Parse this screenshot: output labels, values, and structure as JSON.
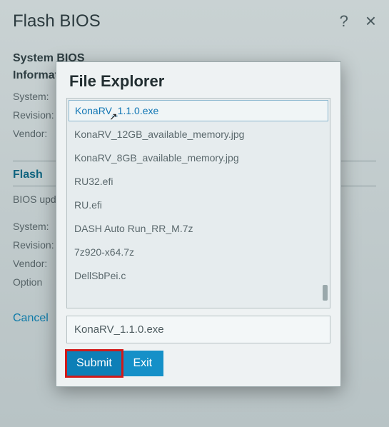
{
  "window": {
    "title": "Flash BIOS",
    "help_icon": "?",
    "close_icon": "×"
  },
  "background": {
    "section1_line1": "System BIOS",
    "section1_line2": "Information",
    "rows1": {
      "system": "System:",
      "revision": "Revision:",
      "vendor": "Vendor:"
    },
    "section2": "Flash",
    "rows2": {
      "bios_update": "BIOS update",
      "system": "System:",
      "revision": "Revision:",
      "vendor": "Vendor:",
      "option": "Option"
    },
    "cancel": "Cancel"
  },
  "modal": {
    "title": "File Explorer",
    "files": [
      "KonaRV_1.1.0.exe",
      "KonaRV_12GB_available_memory.jpg",
      "KonaRV_8GB_available_memory.jpg",
      "RU32.efi",
      "RU.efi",
      "DASH Auto Run_RR_M.7z",
      "7z920-x64.7z",
      "DellSbPei.c"
    ],
    "selected_index": 0,
    "filename_value": "KonaRV_1.1.0.exe",
    "submit_label": "Submit",
    "exit_label": "Exit"
  }
}
